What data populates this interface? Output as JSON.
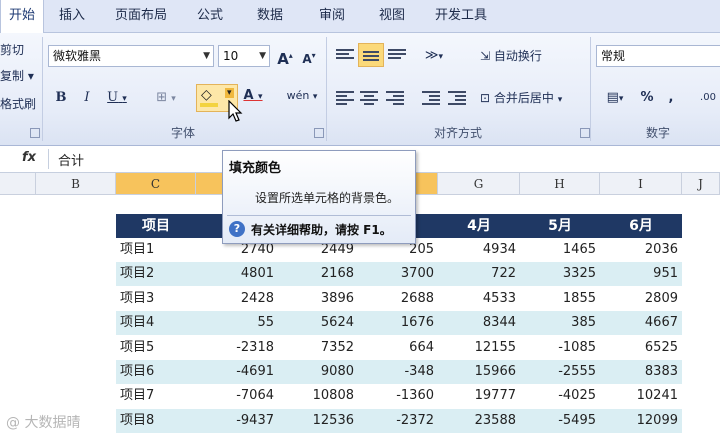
{
  "tabs": [
    "开始",
    "插入",
    "页面布局",
    "公式",
    "数据",
    "审阅",
    "视图",
    "开发工具"
  ],
  "clipboard": {
    "cut": "剪切",
    "copy": "复制",
    "format_painter": "格式刷"
  },
  "font": {
    "family": "微软雅黑",
    "size": "10",
    "grow_label": "A",
    "shrink_label": "A",
    "bold": "B",
    "italic": "I",
    "underline": "U",
    "font_color_label": "A",
    "pinyin_label": "wén",
    "group_label": "字体"
  },
  "alignment": {
    "wrap_text": "自动换行",
    "merge_center": "合并后居中",
    "group_label": "对齐方式"
  },
  "number": {
    "format": "常规",
    "percent": "%",
    "comma": ",",
    "decimal": ".00",
    "group_label": "数字"
  },
  "formula_bar": {
    "fx": "fx",
    "value": "合计"
  },
  "columns": [
    "B",
    "C",
    "G",
    "H",
    "I",
    "J"
  ],
  "tooltip": {
    "title": "填充颜色",
    "description": "设置所选单元格的背景色。",
    "help_icon": "?",
    "help": "有关详细帮助，请按 F1。"
  },
  "table": {
    "headers": [
      "项目",
      "4月",
      "5月",
      "6月"
    ],
    "rows": [
      {
        "name": "项目1",
        "values": [
          "2740",
          "2449",
          "205",
          "4934",
          "1465",
          "2036"
        ]
      },
      {
        "name": "项目2",
        "values": [
          "4801",
          "2168",
          "3700",
          "722",
          "3325",
          "951"
        ]
      },
      {
        "name": "项目3",
        "values": [
          "2428",
          "3896",
          "2688",
          "4533",
          "1855",
          "2809"
        ]
      },
      {
        "name": "项目4",
        "values": [
          "55",
          "5624",
          "1676",
          "8344",
          "385",
          "4667"
        ]
      },
      {
        "name": "项目5",
        "values": [
          "-2318",
          "7352",
          "664",
          "12155",
          "-1085",
          "6525"
        ]
      },
      {
        "name": "项目6",
        "values": [
          "-4691",
          "9080",
          "-348",
          "15966",
          "-2555",
          "8383"
        ]
      },
      {
        "name": "项目7",
        "values": [
          "-7064",
          "10808",
          "-1360",
          "19777",
          "-4025",
          "10241"
        ]
      },
      {
        "name": "项目8",
        "values": [
          "-9437",
          "12536",
          "-2372",
          "23588",
          "-5495",
          "12099"
        ]
      }
    ]
  },
  "watermark": "@ 大数据晴",
  "colors": {
    "header_bg": "#1f3864",
    "band": "#daeef3",
    "selected_col": "#f7c35c",
    "accent": "#3f72c6"
  }
}
